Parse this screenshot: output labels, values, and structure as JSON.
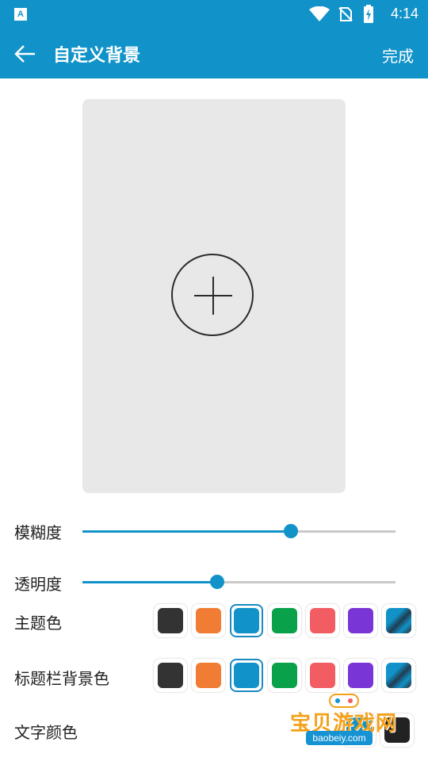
{
  "status_bar": {
    "app_icon": "A",
    "time": "4:14",
    "icons": [
      "wifi-icon",
      "no-sim-icon",
      "battery-charging-icon"
    ]
  },
  "app_bar": {
    "back_icon": "arrow-left-icon",
    "title": "自定义背景",
    "done_label": "完成",
    "background": "#1193c9"
  },
  "preview": {
    "background": "#e8e8e8",
    "add_icon": "plus-circle-icon"
  },
  "blur": {
    "label": "模糊度",
    "value_fraction": 0.667
  },
  "opacity": {
    "label": "透明度",
    "value_fraction": 0.43
  },
  "theme_color": {
    "label": "主题色",
    "selected_index": 2,
    "options": [
      "#333333",
      "#f07d33",
      "#1193c9",
      "#0aa14b",
      "#f25d63",
      "#7a35d6",
      "gradient-blue-dark"
    ]
  },
  "titlebar_bg_color": {
    "label": "标题栏背景色",
    "selected_index": 2,
    "options": [
      "#333333",
      "#f07d33",
      "#1193c9",
      "#0aa14b",
      "#f25d63",
      "#7a35d6",
      "gradient-blue-dark"
    ]
  },
  "text_color": {
    "label": "文字颜色",
    "options": [
      "#1193c9",
      "#222222"
    ]
  },
  "watermark": {
    "main": "宝贝游戏网",
    "sub": "baobeiy.com"
  }
}
